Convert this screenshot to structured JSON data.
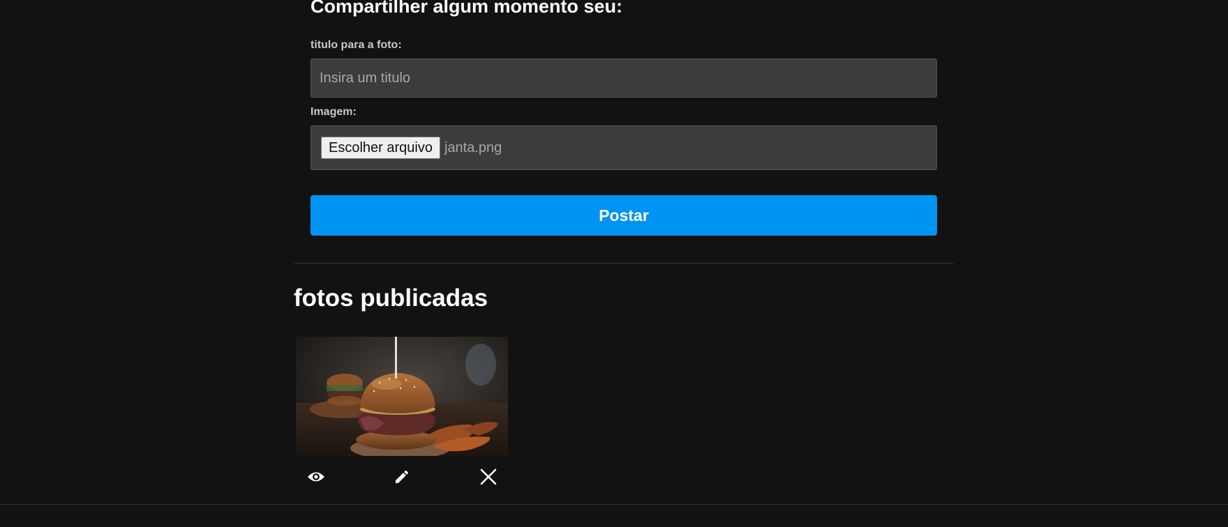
{
  "share_form": {
    "heading": "Compartilher algum momento seu:",
    "title_label": "titulo para a foto:",
    "title_placeholder": "Insira um titulo",
    "title_value": "",
    "image_label": "Imagem:",
    "file_button_label": "Escolher arquivo",
    "file_name": "janta.png",
    "submit_label": "Postar"
  },
  "published": {
    "heading": "fotos publicadas",
    "photos": [
      {
        "image": "burger-photo",
        "actions": [
          {
            "name": "view",
            "icon": "eye-icon"
          },
          {
            "name": "edit",
            "icon": "pencil-icon"
          },
          {
            "name": "delete",
            "icon": "close-icon"
          }
        ]
      }
    ]
  },
  "colors": {
    "background": "#121212",
    "input_background": "#3c3c3c",
    "primary_button": "#0094f2",
    "label_text": "#c8c8c8",
    "divider": "#333333"
  }
}
